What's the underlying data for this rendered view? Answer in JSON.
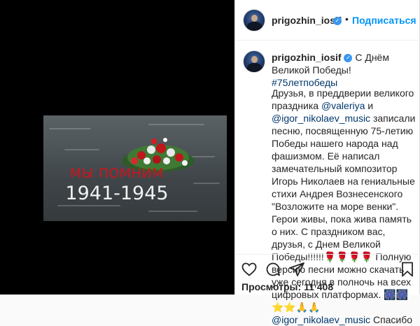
{
  "post": {
    "username": "prigozhin_iosif",
    "follow_label": "Подписаться",
    "dot": "•",
    "video": {
      "overlay_red": "МЫ ПОМНИМ",
      "overlay_years": "1941-1945"
    },
    "comment": {
      "text_1": " С Днём Великой Победы! ",
      "hashtag": "#75летпобеды"
    },
    "caption": {
      "part_1": "Друзья, в преддверии великого праздника ",
      "mention_1": "@valeriya",
      "part_2": " и ",
      "mention_2": "@igor_nikolaev_music",
      "part_3": " записали песню, посвященную 75-летию Победы нашего народа над фашизмом. Её написал замечательный композитор Игорь Николаев на гениальные стихи Андрея Вознесенского \"Возложите на море венки\". Герои живы, пока жива память о них. С праздником вас, друзья, с Днем Великой Победы!!!!!!",
      "emoji_1": "🌹🌹🌹🌹",
      "part_4": " Полную версию песни можно скачать уже сегодня в полночь на всех цифровых платформах. ",
      "emoji_2": "🎆🎆 ⭐⭐🙏🙏",
      "mention_3": "@igor_nikolaev_music",
      "part_5": " Спасибо"
    },
    "views_label": "Просмотры:",
    "views_count": "11 408"
  },
  "icons": {
    "like": "heart-icon",
    "comment": "comment-icon",
    "share": "share-icon",
    "save": "bookmark-icon",
    "verified": "verified-badge-icon"
  },
  "colors": {
    "accent": "#0095f6",
    "verified": "#3897f0",
    "link": "#00376b",
    "overlay_red": "#d0141b"
  }
}
